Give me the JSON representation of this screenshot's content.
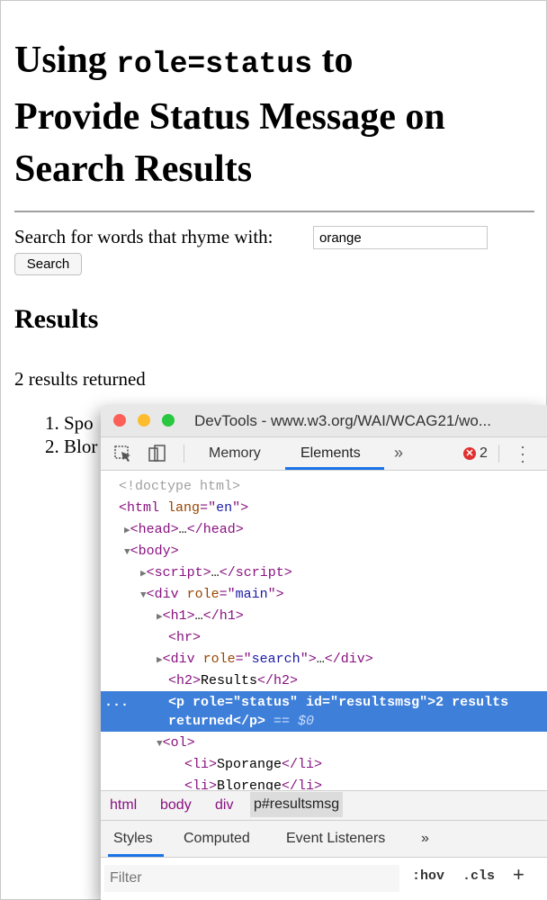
{
  "page": {
    "h1_prefix": "Using ",
    "h1_code": "role=status",
    "h1_suffix_line1": " to",
    "h1_line2": "Provide Status Message on",
    "h1_line3": "Search Results",
    "search_label": "Search for words that rhyme with:",
    "search_value": "orange",
    "search_button": "Search",
    "results_heading": "Results",
    "results_message": "2 results returned",
    "results_list": [
      "1. Spo",
      "2. Blor"
    ]
  },
  "devtools": {
    "title": "DevTools - www.w3.org/WAI/WCAG21/wo...",
    "tabs": [
      "Memory",
      "Elements"
    ],
    "active_tab": "Elements",
    "more_tabs": "»",
    "error_count": "2",
    "error_glyph": "✕",
    "dom": {
      "doctype": "<!doctype html>",
      "html_tag": "html",
      "html_attr": "lang",
      "html_val": "en",
      "head": "head",
      "body": "body",
      "script": "script",
      "div_main_attr": "role",
      "div_main_val": "main",
      "h1": "h1",
      "hr": "hr",
      "div_search_val": "search",
      "h2_text": "Results",
      "p_id_val": "resultsmsg",
      "p_text_line1": "2 results",
      "p_text_line2": "returned",
      "dollar_zero": "== $0",
      "ol": "ol",
      "li1": "Sporange",
      "li2": "Blorenge",
      "ellipsis": "…",
      "row_dots": "..."
    },
    "breadcrumbs": [
      "html",
      "body",
      "div",
      "p#resultsmsg"
    ],
    "subtabs": [
      "Styles",
      "Computed",
      "Event Listeners",
      "»"
    ],
    "filter_placeholder": "Filter",
    "hov_label": ":hov",
    "cls_label": ".cls",
    "plus_label": "+"
  }
}
